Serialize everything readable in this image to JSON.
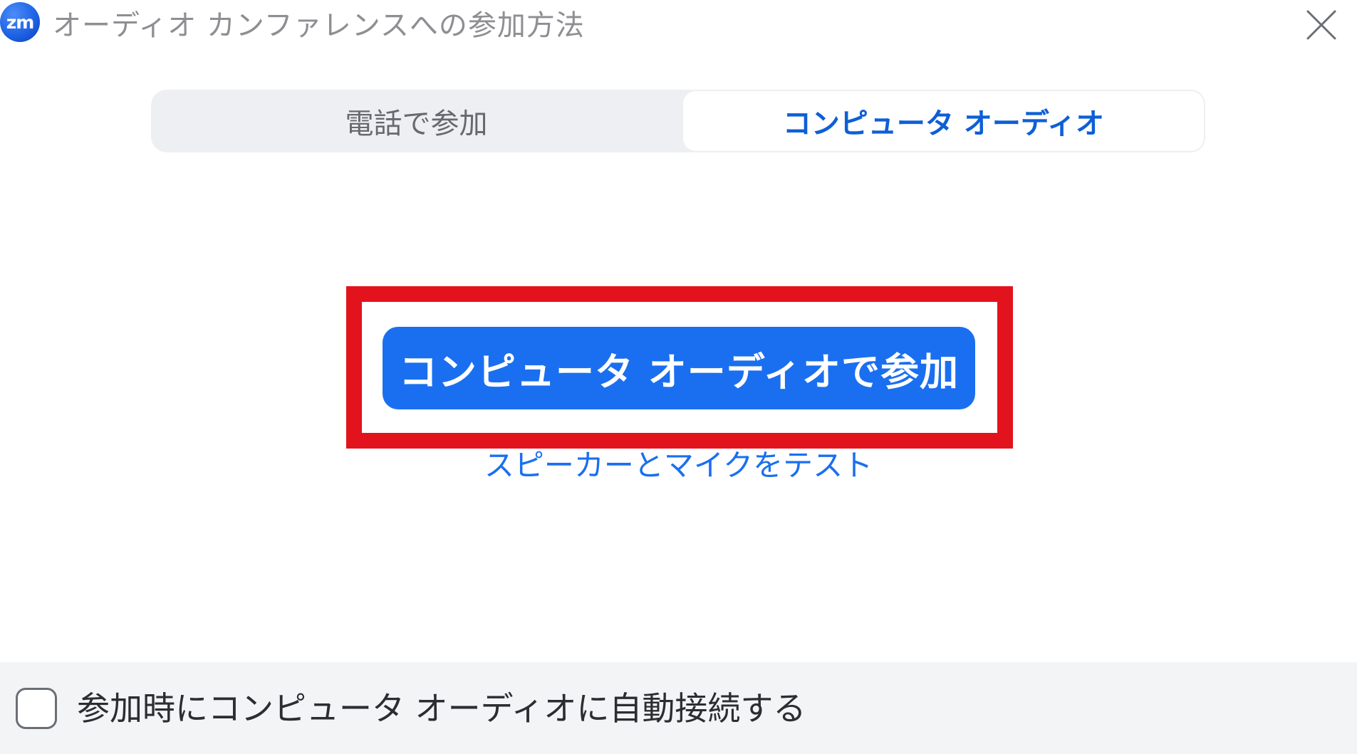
{
  "window": {
    "logo_text": "zm",
    "title": "オーディオ カンファレンスへの参加方法",
    "close_icon": "close-icon"
  },
  "tabs": [
    {
      "label": "電話で参加",
      "selected": false
    },
    {
      "label": "コンピュータ オーディオ",
      "selected": true
    }
  ],
  "main": {
    "join_button_label": "コンピュータ オーディオで参加",
    "test_link_label": "スピーカーとマイクをテスト",
    "highlight_color": "#e3131e",
    "accent_color": "#1a6ff0"
  },
  "footer": {
    "auto_connect_checked": false,
    "auto_connect_label": "参加時にコンピュータ オーディオに自動接続する"
  }
}
